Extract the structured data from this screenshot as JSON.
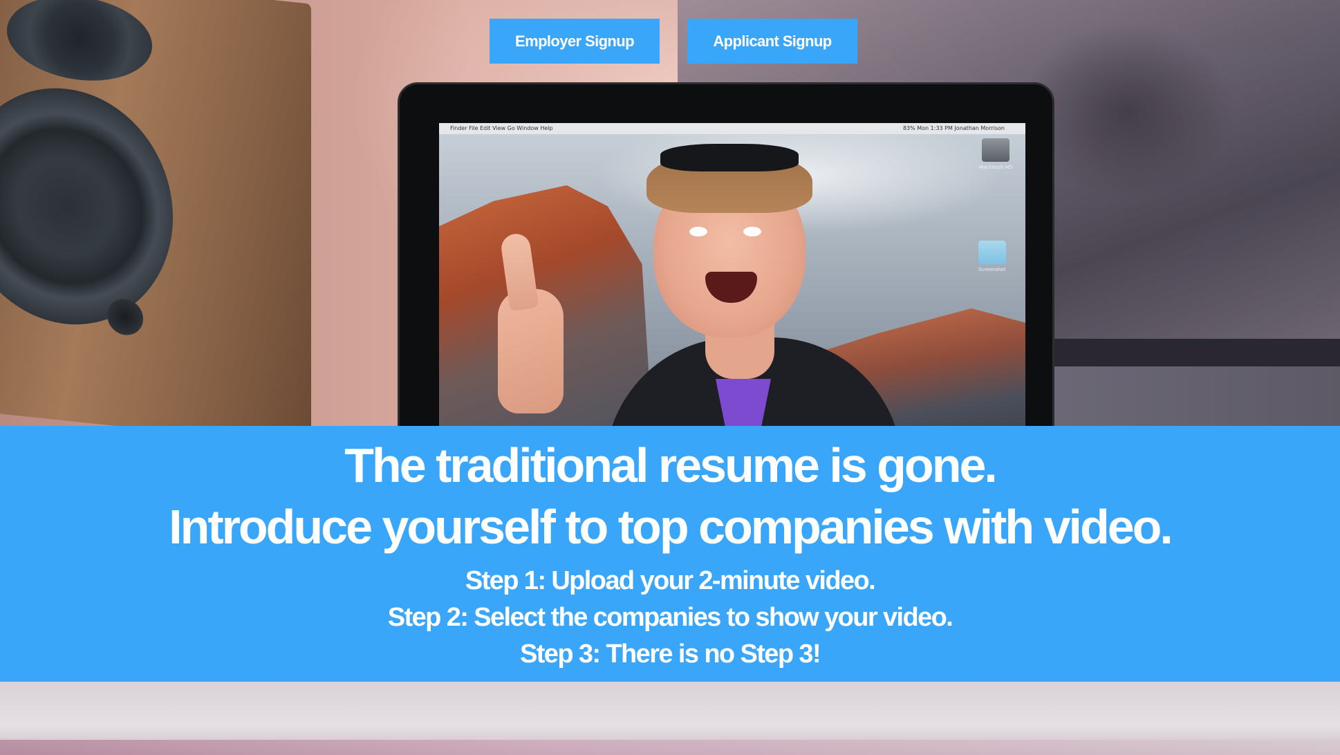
{
  "header": {
    "employer_signup_label": "Employer Signup",
    "applicant_signup_label": "Applicant Signup"
  },
  "hero": {
    "headline_line1": "The traditional resume is gone.",
    "headline_line2": "Introduce yourself to top companies  with video.",
    "steps": [
      "Step 1: Upload your 2-minute video.",
      "Step 2: Select the companies to show your video.",
      "Step 3: There is no Step 3!"
    ]
  },
  "laptop_screen": {
    "menubar_left": "Finder   File   Edit   View   Go   Window   Help",
    "menubar_right": "83%   Mon 1:33 PM   Jonathan Morrison",
    "desktop_icons": [
      "Macintosh HD",
      "Screenshot"
    ]
  },
  "colors": {
    "accent_blue": "#3aa6f9",
    "text_white": "#ffffff"
  },
  "icons": [
    "hard-drive-icon",
    "folder-icon",
    "apple-logo-icon"
  ]
}
